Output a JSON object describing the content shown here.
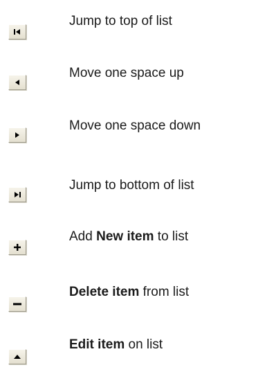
{
  "legend": {
    "items": [
      {
        "icon": "jump-to-top-icon",
        "bold": "",
        "text": "Jump to top of list"
      },
      {
        "icon": "move-up-icon",
        "bold": "",
        "text": "Move one space up"
      },
      {
        "icon": "move-down-icon",
        "bold": "",
        "text": "Move one space down"
      },
      {
        "icon": "jump-to-bottom-icon",
        "bold": "",
        "text": "Jump to bottom of list"
      },
      {
        "icon": "plus-icon",
        "bold": "New item",
        "prefix": "Add ",
        "suffix": " to list"
      },
      {
        "icon": "minus-icon",
        "bold": "Delete item",
        "prefix": "",
        "suffix": " from list"
      },
      {
        "icon": "caret-up-icon",
        "bold": "Edit item",
        "prefix": "",
        "suffix": " on list"
      }
    ]
  }
}
